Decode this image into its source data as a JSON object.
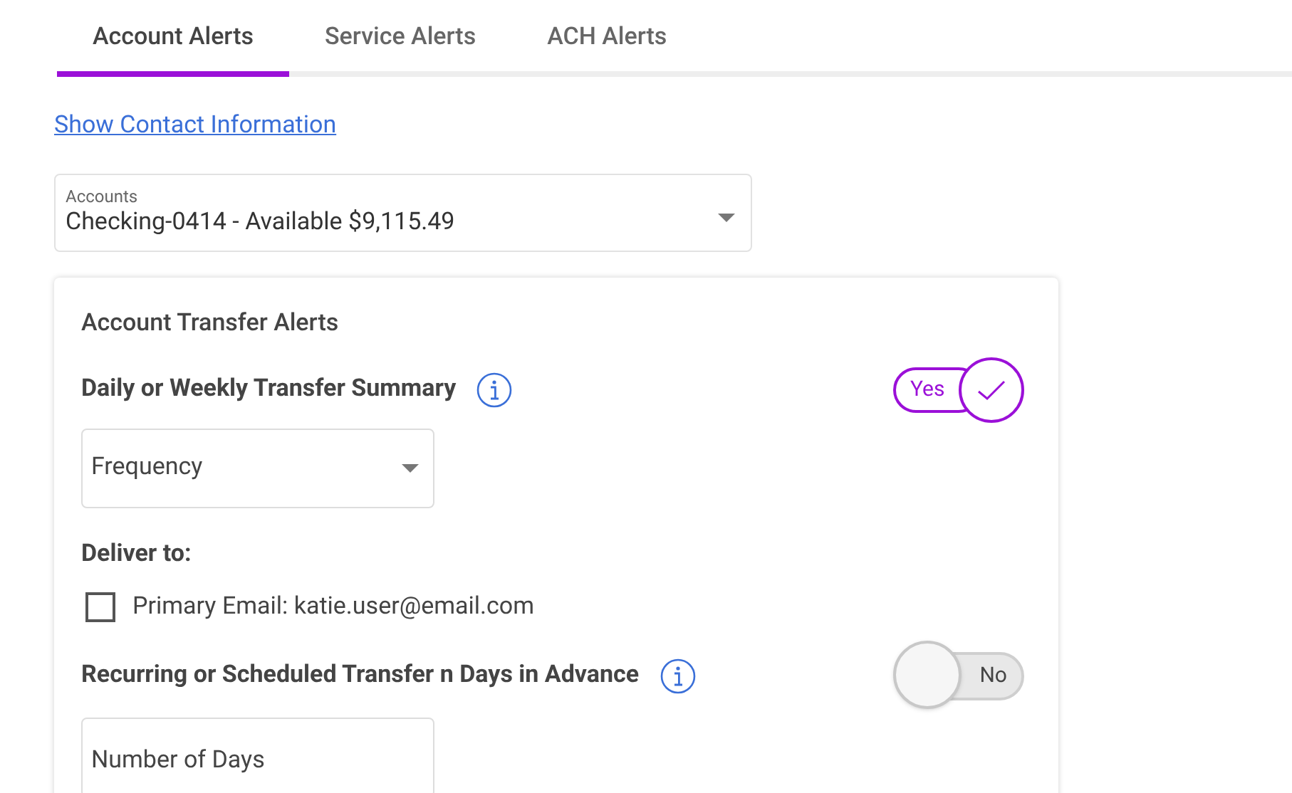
{
  "tabs": [
    {
      "label": "Account Alerts",
      "selected": true
    },
    {
      "label": "Service Alerts",
      "selected": false
    },
    {
      "label": "ACH Alerts",
      "selected": false
    }
  ],
  "contact_link": "Show Contact Information",
  "account_select": {
    "label": "Accounts",
    "value": "Checking-0414 - Available $9,115.49"
  },
  "card": {
    "title": "Account Transfer Alerts",
    "alerts": [
      {
        "title": "Daily or Weekly Transfer Summary",
        "toggle": {
          "on": true,
          "label": "Yes"
        },
        "field": {
          "kind": "select",
          "placeholder": "Frequency"
        },
        "deliver_to": {
          "label": "Deliver to:",
          "options": [
            {
              "label": "Primary Email: katie.user@email.com",
              "checked": false
            }
          ]
        }
      },
      {
        "title": "Recurring or Scheduled Transfer n Days in Advance",
        "toggle": {
          "on": false,
          "label": "No"
        },
        "field": {
          "kind": "input",
          "placeholder": "Number of Days"
        }
      }
    ]
  }
}
